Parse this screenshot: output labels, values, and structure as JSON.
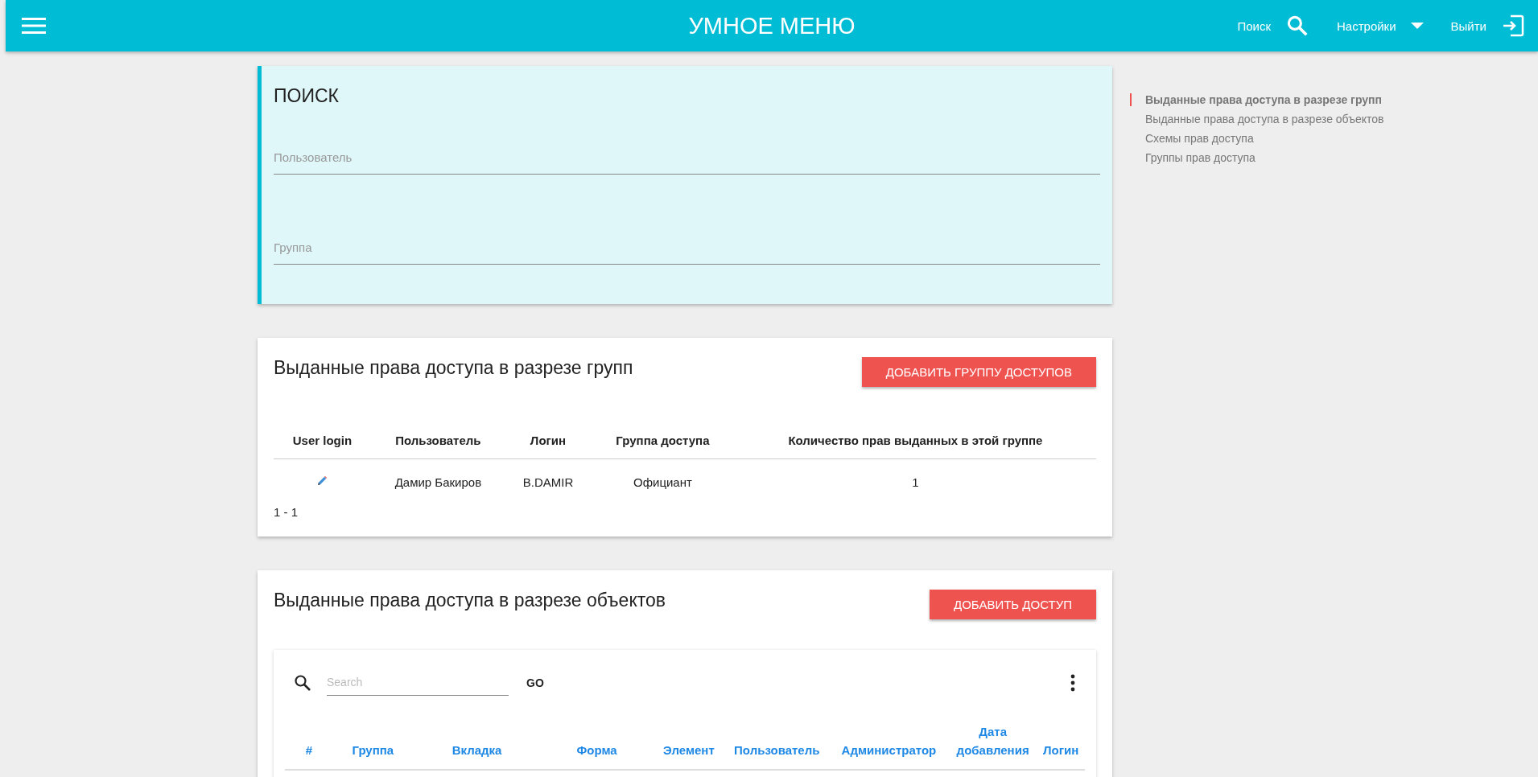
{
  "header": {
    "title": "УМНОЕ МЕНЮ",
    "search_label": "Поиск",
    "settings_label": "Настройки",
    "logout_label": "Выйти"
  },
  "search_card": {
    "title": "ПОИСК",
    "fields": [
      {
        "placeholder": "Пользователь"
      },
      {
        "placeholder": "Группа"
      }
    ]
  },
  "groups_card": {
    "title": "Выданные права доступа в разрезе групп",
    "button": "ДОБАВИТЬ ГРУППУ ДОСТУПОВ",
    "columns": [
      "User login",
      "Пользователь",
      "Логин",
      "Группа доступа",
      "Количество прав выданных в этой группе"
    ],
    "rows": [
      {
        "user": "Дамир Бакиров",
        "login": "B.DAMIR",
        "group": "Официант",
        "count": "1"
      }
    ],
    "pagination": "1 - 1"
  },
  "objects_card": {
    "title": "Выданные права доступа в разрезе объектов",
    "button": "ДОБАВИТЬ ДОСТУП",
    "search": {
      "placeholder": "Search"
    },
    "go": "GO",
    "columns": [
      "#",
      "Группа",
      "Вкладка",
      "Форма",
      "Элемент",
      "Пользователь",
      "Администратор",
      "Дата добавления",
      "Логин"
    ]
  },
  "toc": [
    {
      "label": "Выданные права доступа в разрезе групп",
      "selected": true
    },
    {
      "label": "Выданные права доступа в разрезе объектов",
      "selected": false
    },
    {
      "label": "Схемы прав доступа",
      "selected": false
    },
    {
      "label": "Группы прав доступа",
      "selected": false
    }
  ]
}
